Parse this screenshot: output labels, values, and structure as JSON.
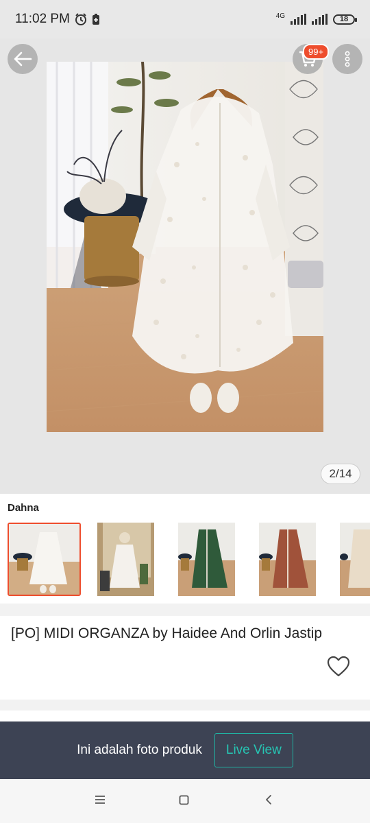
{
  "status_bar": {
    "time": "11:02 PM",
    "network": "4G",
    "battery": "18"
  },
  "header": {
    "cart_badge": "99+"
  },
  "gallery": {
    "counter": "2/14"
  },
  "variants": {
    "label": "Dahna",
    "items": [
      {
        "color": "#f1eeea",
        "selected": true
      },
      {
        "color": "#f4f1ec",
        "selected": false
      },
      {
        "color": "#2f5a3a",
        "selected": false
      },
      {
        "color": "#a0523a",
        "selected": false
      },
      {
        "color": "#e9dcc8",
        "selected": false
      }
    ]
  },
  "product": {
    "title": "[PO] MIDI ORGANZA by Haidee And Orlin Jastip"
  },
  "live_banner": {
    "text": "Ini adalah foto produk",
    "button": "Live View"
  },
  "colors": {
    "accent": "#ee4d2d",
    "teal": "#26c6b4",
    "banner": "#3d4354"
  }
}
